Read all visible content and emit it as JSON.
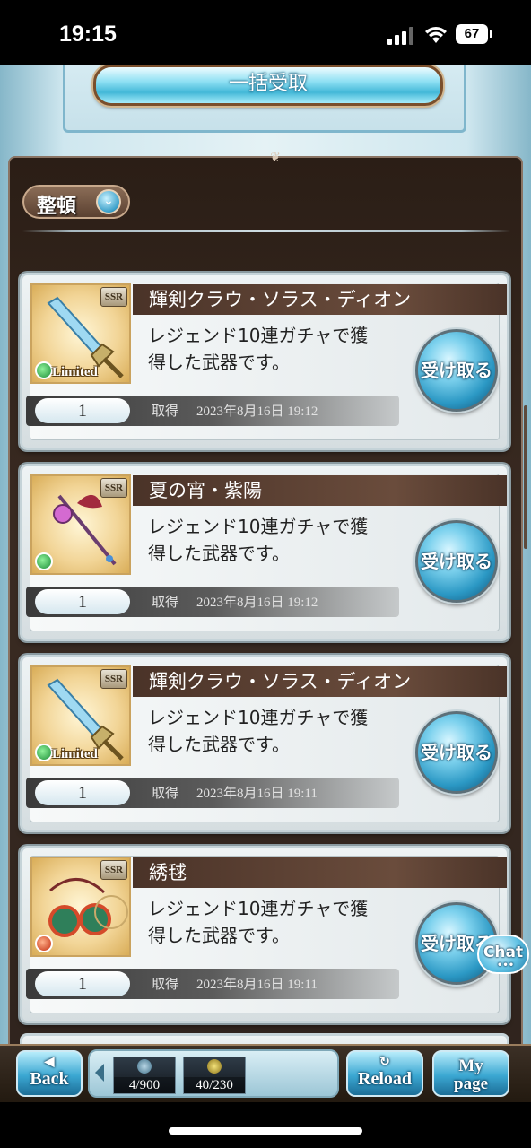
{
  "status_bar": {
    "time": "19:15",
    "battery": "67"
  },
  "header": {
    "bulk_receive_label": "一括受取"
  },
  "sort": {
    "label": "整頓"
  },
  "items": [
    {
      "name": "輝剣クラウ・ソラス・ディオン",
      "rarity": "SSR",
      "badge": "Limited",
      "element": "wind",
      "description_line1": "レジェンド10連ガチャで獲",
      "description_line2": "得した武器です。",
      "quantity": "1",
      "acquired_label": "取得",
      "acquired_date": "2023年8月16日 19:12",
      "receive_label": "受け取る"
    },
    {
      "name": "夏の宵・紫陽",
      "rarity": "SSR",
      "badge": "",
      "element": "wind",
      "description_line1": "レジェンド10連ガチャで獲",
      "description_line2": "得した武器です。",
      "quantity": "1",
      "acquired_label": "取得",
      "acquired_date": "2023年8月16日 19:12",
      "receive_label": "受け取る"
    },
    {
      "name": "輝剣クラウ・ソラス・ディオン",
      "rarity": "SSR",
      "badge": "Limited",
      "element": "wind",
      "description_line1": "レジェンド10連ガチャで獲",
      "description_line2": "得した武器です。",
      "quantity": "1",
      "acquired_label": "取得",
      "acquired_date": "2023年8月16日 19:11",
      "receive_label": "受け取る"
    },
    {
      "name": "綉毬",
      "rarity": "SSR",
      "badge": "",
      "element": "fire",
      "description_line1": "レジェンド10連ガチャで獲",
      "description_line2": "得した武器です。",
      "quantity": "1",
      "acquired_label": "取得",
      "acquired_date": "2023年8月16日 19:11",
      "receive_label": "受け取る"
    }
  ],
  "chat": {
    "label": "Chat"
  },
  "nav": {
    "back_label": "Back",
    "reload_label": "Reload",
    "mypage_line1": "My",
    "mypage_line2": "page",
    "quick": [
      {
        "value": "4/900"
      },
      {
        "value": "40/230"
      }
    ]
  },
  "colors": {
    "frame": "#2b1e16",
    "title_bar": "#4a3328",
    "accent": "#2b98c4"
  }
}
